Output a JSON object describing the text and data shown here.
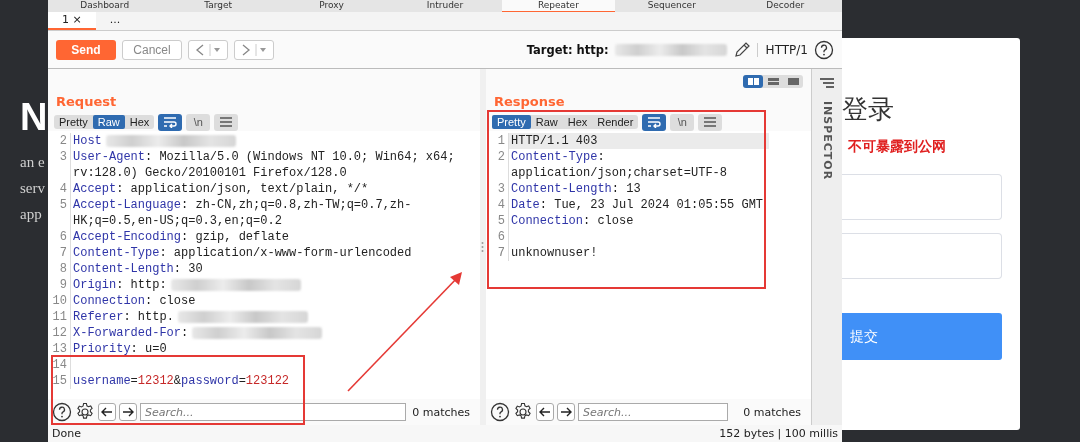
{
  "background_page": {
    "heading_letter": "N",
    "text_fragments": [
      "an e",
      "serv",
      "app"
    ],
    "login": {
      "title": "登录",
      "warning": "不可暴露到公网",
      "fields": [
        {
          "kind": "input"
        },
        {
          "kind": "input"
        }
      ],
      "submit": "提交"
    }
  },
  "top_tabs": [
    {
      "label": "Dashboard",
      "selected": false
    },
    {
      "label": "Target",
      "selected": false
    },
    {
      "label": "Proxy",
      "selected": false
    },
    {
      "label": "Intruder",
      "selected": false
    },
    {
      "label": "Repeater",
      "selected": true
    },
    {
      "label": "Sequencer",
      "selected": false
    },
    {
      "label": "Decoder",
      "selected": false
    }
  ],
  "sub_tabs": [
    {
      "label": "1 ×",
      "selected": true
    },
    {
      "label": "...",
      "selected": false
    }
  ],
  "toolbar": {
    "send": "Send",
    "cancel": "Cancel",
    "target_label": "Target: http:",
    "target_redacted": true,
    "protocol": "HTTP/1"
  },
  "request": {
    "title": "Request",
    "views": [
      {
        "label": "Pretty",
        "selected": false
      },
      {
        "label": "Raw",
        "selected": true
      },
      {
        "label": "Hex",
        "selected": false
      }
    ],
    "tools": [
      {
        "kind": "wrap",
        "selected": true
      },
      {
        "kind": "newline",
        "label": "\\n",
        "selected": false
      },
      {
        "kind": "menu",
        "selected": false
      }
    ],
    "lines": [
      {
        "number": "2",
        "segments": [
          {
            "kind": "name",
            "text": "Host"
          }
        ],
        "redacted": true
      },
      {
        "number": "3",
        "segments": [
          {
            "kind": "name",
            "text": "User-Agent"
          },
          {
            "kind": "plain",
            "text": ": Mozilla/5.0 (Windows NT 10.0; Win64; x64; rv:128.0) Gecko/20100101 Firefox/128.0"
          }
        ],
        "redacted": false
      },
      {
        "number": "4",
        "segments": [
          {
            "kind": "name",
            "text": "Accept"
          },
          {
            "kind": "plain",
            "text": ": application/json, text/plain, */*"
          }
        ],
        "redacted": false
      },
      {
        "number": "5",
        "segments": [
          {
            "kind": "name",
            "text": "Accept-Language"
          },
          {
            "kind": "plain",
            "text": ": zh-CN,zh;q=0.8,zh-TW;q=0.7,zh-HK;q=0.5,en-US;q=0.3,en;q=0.2"
          }
        ],
        "redacted": false
      },
      {
        "number": "6",
        "segments": [
          {
            "kind": "name",
            "text": "Accept-Encoding"
          },
          {
            "kind": "plain",
            "text": ": gzip, deflate"
          }
        ],
        "redacted": false
      },
      {
        "number": "7",
        "segments": [
          {
            "kind": "name",
            "text": "Content-Type"
          },
          {
            "kind": "plain",
            "text": ": application/x-www-form-urlencoded"
          }
        ],
        "redacted": false
      },
      {
        "number": "8",
        "segments": [
          {
            "kind": "name",
            "text": "Content-Length"
          },
          {
            "kind": "plain",
            "text": ": 30"
          }
        ],
        "redacted": false
      },
      {
        "number": "9",
        "segments": [
          {
            "kind": "name",
            "text": "Origin"
          },
          {
            "kind": "plain",
            "text": ": http:"
          }
        ],
        "redacted": true
      },
      {
        "number": "10",
        "segments": [
          {
            "kind": "name",
            "text": "Connection"
          },
          {
            "kind": "plain",
            "text": ": close"
          }
        ],
        "redacted": false
      },
      {
        "number": "11",
        "segments": [
          {
            "kind": "name",
            "text": "Referer"
          },
          {
            "kind": "plain",
            "text": ": http."
          }
        ],
        "redacted": true
      },
      {
        "number": "12",
        "segments": [
          {
            "kind": "name",
            "text": "X-Forwarded-For"
          },
          {
            "kind": "plain",
            "text": ":"
          }
        ],
        "redacted": true
      },
      {
        "number": "13",
        "segments": [
          {
            "kind": "name",
            "text": "Priority"
          },
          {
            "kind": "plain",
            "text": ": u=0"
          }
        ],
        "redacted": false
      },
      {
        "number": "14",
        "redacted": false
      },
      {
        "number": "15",
        "segments": [
          {
            "kind": "name",
            "text": "username"
          },
          {
            "kind": "plain",
            "text": "="
          },
          {
            "kind": "value",
            "text": "12312"
          },
          {
            "kind": "plain",
            "text": "&"
          },
          {
            "kind": "name",
            "text": "password"
          },
          {
            "kind": "plain",
            "text": "="
          },
          {
            "kind": "value",
            "text": "123122"
          }
        ],
        "redacted": false
      }
    ],
    "search": {
      "placeholder": "Search...",
      "matches": "0 matches"
    }
  },
  "response": {
    "title": "Response",
    "layout_buttons": [
      {
        "kind": "side-by-side",
        "selected": true
      },
      {
        "kind": "stacked",
        "selected": false
      },
      {
        "kind": "single",
        "selected": false
      }
    ],
    "views": [
      {
        "label": "Pretty",
        "selected": true
      },
      {
        "label": "Raw",
        "selected": false
      },
      {
        "label": "Hex",
        "selected": false
      },
      {
        "label": "Render",
        "selected": false
      }
    ],
    "tools": [
      {
        "kind": "wrap",
        "selected": true
      },
      {
        "kind": "newline",
        "label": "\\n",
        "selected": false
      },
      {
        "kind": "menu",
        "selected": false
      }
    ],
    "lines": [
      {
        "number": "1",
        "segments": [
          {
            "kind": "plain",
            "text": "HTTP/1.1 403"
          }
        ],
        "redacted": false,
        "current": true
      },
      {
        "number": "2",
        "segments": [
          {
            "kind": "name",
            "text": "Content-Type"
          },
          {
            "kind": "plain",
            "text": ": application/json;charset=UTF-8"
          }
        ],
        "redacted": false,
        "current": false
      },
      {
        "number": "3",
        "segments": [
          {
            "kind": "name",
            "text": "Content-Length"
          },
          {
            "kind": "plain",
            "text": ": 13"
          }
        ],
        "redacted": false,
        "current": false
      },
      {
        "number": "4",
        "segments": [
          {
            "kind": "name",
            "text": "Date"
          },
          {
            "kind": "plain",
            "text": ": Tue, 23 Jul 2024 01:05:55 GMT"
          }
        ],
        "redacted": false,
        "current": false
      },
      {
        "number": "5",
        "segments": [
          {
            "kind": "name",
            "text": "Connection"
          },
          {
            "kind": "plain",
            "text": ": close"
          }
        ],
        "redacted": false,
        "current": false
      },
      {
        "number": "6",
        "redacted": false,
        "current": false
      },
      {
        "number": "7",
        "segments": [
          {
            "kind": "plain",
            "text": "unknownuser!"
          }
        ],
        "redacted": false,
        "current": false
      }
    ],
    "search": {
      "placeholder": "Search...",
      "matches": "0 matches"
    }
  },
  "inspector": {
    "label": "INSPECTOR"
  },
  "status_bar": {
    "left": "Done",
    "right": "152 bytes | 100 millis"
  }
}
